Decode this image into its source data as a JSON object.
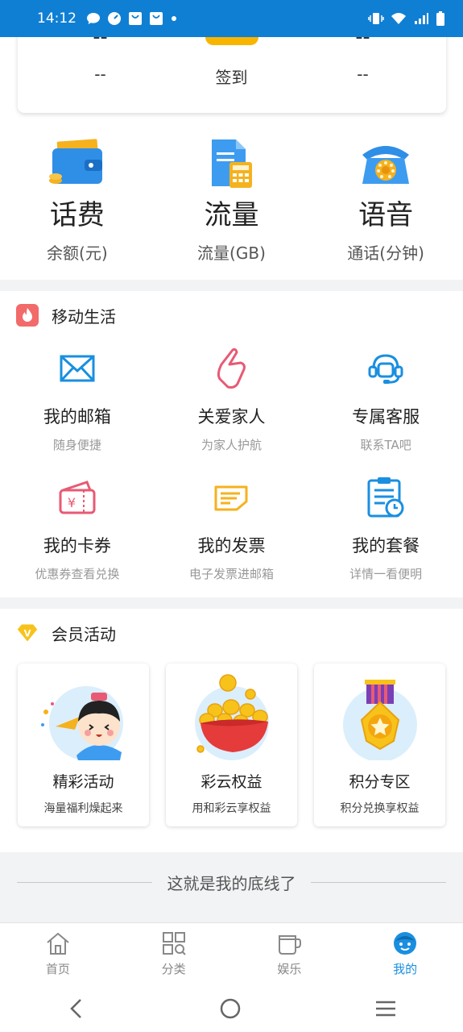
{
  "status_bar": {
    "time": "14:12",
    "notification_icons": [
      "chat-bubble-icon",
      "speedometer-icon",
      "shopping-bag-icon",
      "shopping-bag-icon",
      "dot-icon"
    ],
    "right_icons": [
      "vibrate-icon",
      "wifi-icon",
      "signal-icon",
      "battery-icon"
    ]
  },
  "top_card": {
    "left_value": "--",
    "left_label": "--",
    "center_label": "签到",
    "right_value": "--",
    "right_label": "--"
  },
  "balances": [
    {
      "icon": "wallet-icon",
      "title": "话费",
      "sub": "余额(元)"
    },
    {
      "icon": "data-calculator-icon",
      "title": "流量",
      "sub": "流量(GB)"
    },
    {
      "icon": "telephone-icon",
      "title": "语音",
      "sub": "通话(分钟)"
    }
  ],
  "mobile_life": {
    "title": "移动生活",
    "items": [
      {
        "icon": "mail-icon",
        "title": "我的邮箱",
        "sub": "随身便捷"
      },
      {
        "icon": "pinky-promise-icon",
        "title": "关爱家人",
        "sub": "为家人护航"
      },
      {
        "icon": "headset-icon",
        "title": "专属客服",
        "sub": "联系TA吧"
      },
      {
        "icon": "coupon-icon",
        "title": "我的卡券",
        "sub": "优惠券查看兑换"
      },
      {
        "icon": "invoice-icon",
        "title": "我的发票",
        "sub": "电子发票进邮箱"
      },
      {
        "icon": "plan-clipboard-icon",
        "title": "我的套餐",
        "sub": "详情一看便明"
      }
    ]
  },
  "member": {
    "title": "会员活动",
    "cards": [
      {
        "image": "cartoon-child-illustration",
        "title": "精彩活动",
        "sub": "海量福利燥起来"
      },
      {
        "image": "gold-coins-bowl-illustration",
        "title": "彩云权益",
        "sub": "用和彩云享权益"
      },
      {
        "image": "medal-illustration",
        "title": "积分专区",
        "sub": "积分兑换享权益"
      }
    ]
  },
  "bottom_text": "这就是我的底线了",
  "tabs": [
    {
      "icon": "home-icon",
      "label": "首页",
      "active": false
    },
    {
      "icon": "category-icon",
      "label": "分类",
      "active": false
    },
    {
      "icon": "cup-icon",
      "label": "娱乐",
      "active": false
    },
    {
      "icon": "profile-face-icon",
      "label": "我的",
      "active": true
    }
  ],
  "colors": {
    "status_bar": "#0f7fd4",
    "accent": "#1a8fe0",
    "background": "#f2f3f5"
  }
}
